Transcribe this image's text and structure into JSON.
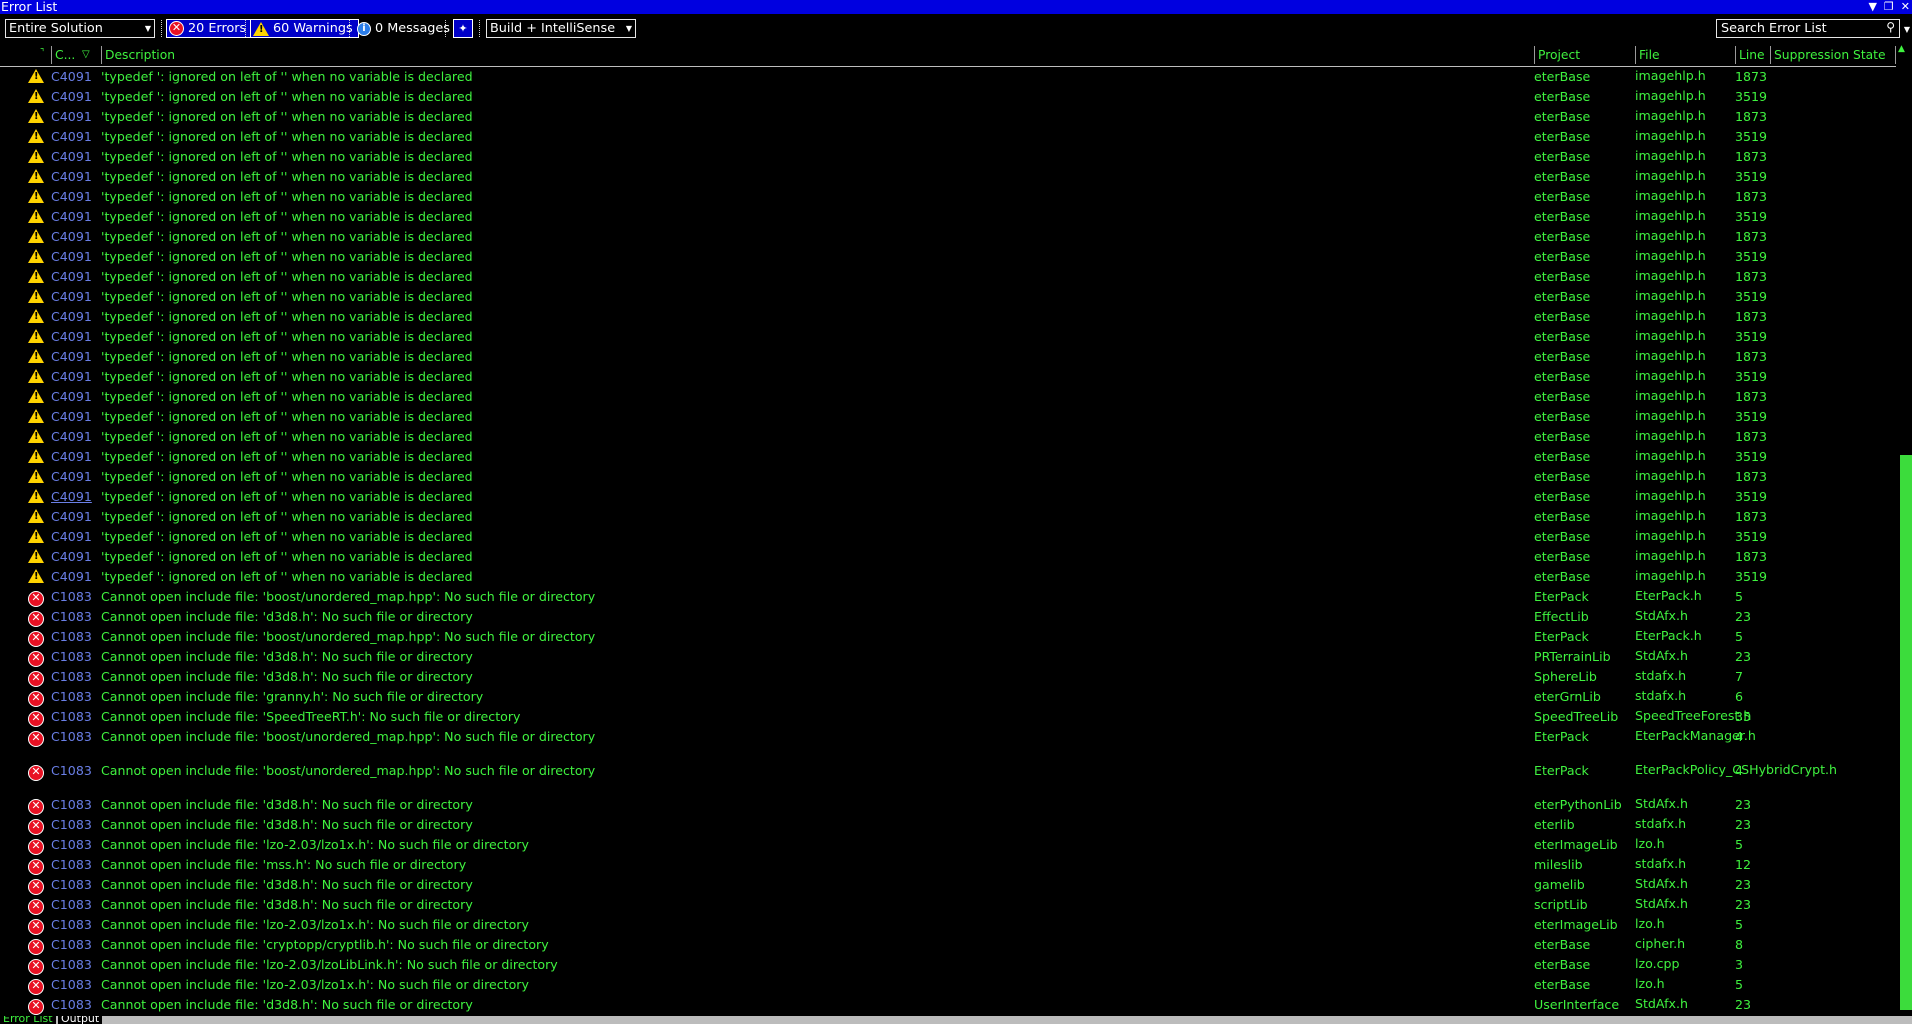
{
  "window": {
    "title": "Error List"
  },
  "toolbar": {
    "scope_selected": "Entire Solution",
    "errors_label": "20 Errors",
    "warnings_label": "60 Warnings",
    "messages_label": "0 Messages",
    "source_selected": "Build + IntelliSense",
    "search_placeholder": "Search Error List"
  },
  "columns": {
    "code": "C...",
    "description": "Description",
    "project": "Project",
    "file": "File",
    "line": "Line",
    "suppression": "Suppression State"
  },
  "warning_desc": "'typedef ': ignored on left of '' when no variable is declared",
  "rows": [
    {
      "type": "warning",
      "code": "C4091",
      "description": "'typedef ': ignored on left of '' when no variable is declared",
      "project": "eterBase",
      "file": "imagehlp.h",
      "line": "1873"
    },
    {
      "type": "warning",
      "code": "C4091",
      "description": "'typedef ': ignored on left of '' when no variable is declared",
      "project": "eterBase",
      "file": "imagehlp.h",
      "line": "3519"
    },
    {
      "type": "warning",
      "code": "C4091",
      "description": "'typedef ': ignored on left of '' when no variable is declared",
      "project": "eterBase",
      "file": "imagehlp.h",
      "line": "1873"
    },
    {
      "type": "warning",
      "code": "C4091",
      "description": "'typedef ': ignored on left of '' when no variable is declared",
      "project": "eterBase",
      "file": "imagehlp.h",
      "line": "3519"
    },
    {
      "type": "warning",
      "code": "C4091",
      "description": "'typedef ': ignored on left of '' when no variable is declared",
      "project": "eterBase",
      "file": "imagehlp.h",
      "line": "1873"
    },
    {
      "type": "warning",
      "code": "C4091",
      "description": "'typedef ': ignored on left of '' when no variable is declared",
      "project": "eterBase",
      "file": "imagehlp.h",
      "line": "3519"
    },
    {
      "type": "warning",
      "code": "C4091",
      "description": "'typedef ': ignored on left of '' when no variable is declared",
      "project": "eterBase",
      "file": "imagehlp.h",
      "line": "1873"
    },
    {
      "type": "warning",
      "code": "C4091",
      "description": "'typedef ': ignored on left of '' when no variable is declared",
      "project": "eterBase",
      "file": "imagehlp.h",
      "line": "3519"
    },
    {
      "type": "warning",
      "code": "C4091",
      "description": "'typedef ': ignored on left of '' when no variable is declared",
      "project": "eterBase",
      "file": "imagehlp.h",
      "line": "1873"
    },
    {
      "type": "warning",
      "code": "C4091",
      "description": "'typedef ': ignored on left of '' when no variable is declared",
      "project": "eterBase",
      "file": "imagehlp.h",
      "line": "3519"
    },
    {
      "type": "warning",
      "code": "C4091",
      "description": "'typedef ': ignored on left of '' when no variable is declared",
      "project": "eterBase",
      "file": "imagehlp.h",
      "line": "1873"
    },
    {
      "type": "warning",
      "code": "C4091",
      "description": "'typedef ': ignored on left of '' when no variable is declared",
      "project": "eterBase",
      "file": "imagehlp.h",
      "line": "3519"
    },
    {
      "type": "warning",
      "code": "C4091",
      "description": "'typedef ': ignored on left of '' when no variable is declared",
      "project": "eterBase",
      "file": "imagehlp.h",
      "line": "1873"
    },
    {
      "type": "warning",
      "code": "C4091",
      "description": "'typedef ': ignored on left of '' when no variable is declared",
      "project": "eterBase",
      "file": "imagehlp.h",
      "line": "3519"
    },
    {
      "type": "warning",
      "code": "C4091",
      "description": "'typedef ': ignored on left of '' when no variable is declared",
      "project": "eterBase",
      "file": "imagehlp.h",
      "line": "1873"
    },
    {
      "type": "warning",
      "code": "C4091",
      "description": "'typedef ': ignored on left of '' when no variable is declared",
      "project": "eterBase",
      "file": "imagehlp.h",
      "line": "3519"
    },
    {
      "type": "warning",
      "code": "C4091",
      "description": "'typedef ': ignored on left of '' when no variable is declared",
      "project": "eterBase",
      "file": "imagehlp.h",
      "line": "1873"
    },
    {
      "type": "warning",
      "code": "C4091",
      "description": "'typedef ': ignored on left of '' when no variable is declared",
      "project": "eterBase",
      "file": "imagehlp.h",
      "line": "3519"
    },
    {
      "type": "warning",
      "code": "C4091",
      "description": "'typedef ': ignored on left of '' when no variable is declared",
      "project": "eterBase",
      "file": "imagehlp.h",
      "line": "1873"
    },
    {
      "type": "warning",
      "code": "C4091",
      "description": "'typedef ': ignored on left of '' when no variable is declared",
      "project": "eterBase",
      "file": "imagehlp.h",
      "line": "3519"
    },
    {
      "type": "warning",
      "code": "C4091",
      "description": "'typedef ': ignored on left of '' when no variable is declared",
      "project": "eterBase",
      "file": "imagehlp.h",
      "line": "1873"
    },
    {
      "type": "warning",
      "code": "C4091",
      "description": "'typedef ': ignored on left of '' when no variable is declared",
      "project": "eterBase",
      "file": "imagehlp.h",
      "line": "3519",
      "underline": true
    },
    {
      "type": "warning",
      "code": "C4091",
      "description": "'typedef ': ignored on left of '' when no variable is declared",
      "project": "eterBase",
      "file": "imagehlp.h",
      "line": "1873"
    },
    {
      "type": "warning",
      "code": "C4091",
      "description": "'typedef ': ignored on left of '' when no variable is declared",
      "project": "eterBase",
      "file": "imagehlp.h",
      "line": "3519"
    },
    {
      "type": "warning",
      "code": "C4091",
      "description": "'typedef ': ignored on left of '' when no variable is declared",
      "project": "eterBase",
      "file": "imagehlp.h",
      "line": "1873"
    },
    {
      "type": "warning",
      "code": "C4091",
      "description": "'typedef ': ignored on left of '' when no variable is declared",
      "project": "eterBase",
      "file": "imagehlp.h",
      "line": "3519"
    },
    {
      "type": "error",
      "code": "C1083",
      "description": "Cannot open include file: 'boost/unordered_map.hpp': No such file or directory",
      "project": "EterPack",
      "file": "EterPack.h",
      "line": "5"
    },
    {
      "type": "error",
      "code": "C1083",
      "description": "Cannot open include file: 'd3d8.h': No such file or directory",
      "project": "EffectLib",
      "file": "StdAfx.h",
      "line": "23"
    },
    {
      "type": "error",
      "code": "C1083",
      "description": "Cannot open include file: 'boost/unordered_map.hpp': No such file or directory",
      "project": "EterPack",
      "file": "EterPack.h",
      "line": "5"
    },
    {
      "type": "error",
      "code": "C1083",
      "description": "Cannot open include file: 'd3d8.h': No such file or directory",
      "project": "PRTerrainLib",
      "file": "StdAfx.h",
      "line": "23"
    },
    {
      "type": "error",
      "code": "C1083",
      "description": "Cannot open include file: 'd3d8.h': No such file or directory",
      "project": "SphereLib",
      "file": "stdafx.h",
      "line": "7"
    },
    {
      "type": "error",
      "code": "C1083",
      "description": "Cannot open include file: 'granny.h': No such file or directory",
      "project": "eterGrnLib",
      "file": "stdafx.h",
      "line": "6"
    },
    {
      "type": "error",
      "code": "C1083",
      "description": "Cannot open include file: 'SpeedTreeRT.h': No such file or directory",
      "project": "SpeedTreeLib",
      "file": "SpeedTreeForest.h",
      "line": "35"
    },
    {
      "type": "error",
      "code": "C1083",
      "description": "Cannot open include file: 'boost/unordered_map.hpp': No such file or directory",
      "project": "EterPack",
      "file": "EterPackManager.h",
      "line": "4",
      "tall": true
    },
    {
      "type": "error",
      "code": "C1083",
      "description": "Cannot open include file: 'boost/unordered_map.hpp': No such file or directory",
      "project": "EterPack",
      "file": "EterPackPolicy_CSHybridCrypt.h",
      "line": "4",
      "tall": true
    },
    {
      "type": "error",
      "code": "C1083",
      "description": "Cannot open include file: 'd3d8.h': No such file or directory",
      "project": "eterPythonLib",
      "file": "StdAfx.h",
      "line": "23"
    },
    {
      "type": "error",
      "code": "C1083",
      "description": "Cannot open include file: 'd3d8.h': No such file or directory",
      "project": "eterlib",
      "file": "stdafx.h",
      "line": "23"
    },
    {
      "type": "error",
      "code": "C1083",
      "description": "Cannot open include file: 'lzo-2.03/lzo1x.h': No such file or directory",
      "project": "eterImageLib",
      "file": "lzo.h",
      "line": "5"
    },
    {
      "type": "error",
      "code": "C1083",
      "description": "Cannot open include file: 'mss.h': No such file or directory",
      "project": "mileslib",
      "file": "stdafx.h",
      "line": "12"
    },
    {
      "type": "error",
      "code": "C1083",
      "description": "Cannot open include file: 'd3d8.h': No such file or directory",
      "project": "gamelib",
      "file": "StdAfx.h",
      "line": "23"
    },
    {
      "type": "error",
      "code": "C1083",
      "description": "Cannot open include file: 'd3d8.h': No such file or directory",
      "project": "scriptLib",
      "file": "StdAfx.h",
      "line": "23"
    },
    {
      "type": "error",
      "code": "C1083",
      "description": "Cannot open include file: 'lzo-2.03/lzo1x.h': No such file or directory",
      "project": "eterImageLib",
      "file": "lzo.h",
      "line": "5"
    },
    {
      "type": "error",
      "code": "C1083",
      "description": "Cannot open include file: 'cryptopp/cryptlib.h': No such file or directory",
      "project": "eterBase",
      "file": "cipher.h",
      "line": "8"
    },
    {
      "type": "error",
      "code": "C1083",
      "description": "Cannot open include file: 'lzo-2.03/lzoLibLink.h': No such file or directory",
      "project": "eterBase",
      "file": "lzo.cpp",
      "line": "3"
    },
    {
      "type": "error",
      "code": "C1083",
      "description": "Cannot open include file: 'lzo-2.03/lzo1x.h': No such file or directory",
      "project": "eterBase",
      "file": "lzo.h",
      "line": "5"
    },
    {
      "type": "error",
      "code": "C1083",
      "description": "Cannot open include file: 'd3d8.h': No such file or directory",
      "project": "UserInterface",
      "file": "StdAfx.h",
      "line": "23"
    }
  ],
  "tabs": [
    {
      "label": "Error List",
      "active": true
    },
    {
      "label": "Output",
      "active": false
    }
  ]
}
